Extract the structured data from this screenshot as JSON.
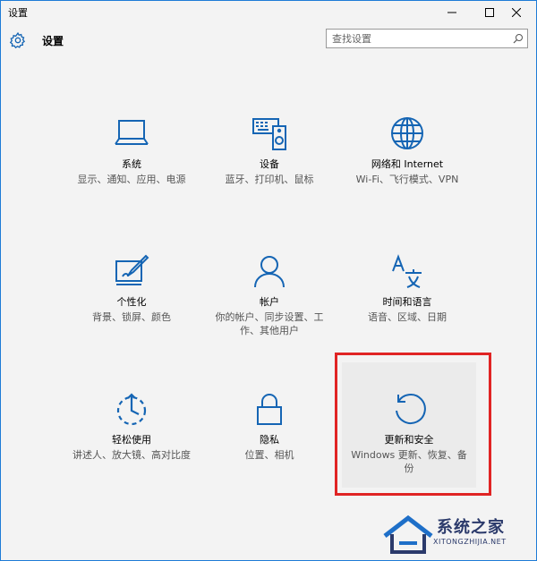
{
  "window": {
    "title": "设置",
    "min_icon": "minimize-icon",
    "max_icon": "maximize-icon",
    "close_icon": "close-icon"
  },
  "header": {
    "title": "设置",
    "search_placeholder": "查找设置"
  },
  "tiles": [
    {
      "id": "system",
      "name": "系统",
      "desc": "显示、通知、应用、电源",
      "icon": "laptop-icon"
    },
    {
      "id": "devices",
      "name": "设备",
      "desc": "蓝牙、打印机、鼠标",
      "icon": "devices-icon"
    },
    {
      "id": "network",
      "name": "网络和 Internet",
      "desc": "Wi-Fi、飞行模式、VPN",
      "icon": "globe-icon"
    },
    {
      "id": "personalization",
      "name": "个性化",
      "desc": "背景、锁屏、颜色",
      "icon": "personalization-icon"
    },
    {
      "id": "accounts",
      "name": "帐户",
      "desc": "你的帐户、同步设置、工作、其他用户",
      "icon": "person-icon"
    },
    {
      "id": "time-language",
      "name": "时间和语言",
      "desc": "语音、区域、日期",
      "icon": "time-language-icon"
    },
    {
      "id": "ease-of-access",
      "name": "轻松使用",
      "desc": "讲述人、放大镜、高对比度",
      "icon": "ease-of-access-icon"
    },
    {
      "id": "privacy",
      "name": "隐私",
      "desc": "位置、相机",
      "icon": "lock-icon"
    },
    {
      "id": "update-security",
      "name": "更新和安全",
      "desc": "Windows 更新、恢复、备份",
      "icon": "refresh-icon"
    }
  ],
  "watermark": {
    "text": "系统之家",
    "sub": "XITONGZHIJIA.NET"
  },
  "colors": {
    "accent": "#1565b4",
    "highlight": "#e02424"
  }
}
